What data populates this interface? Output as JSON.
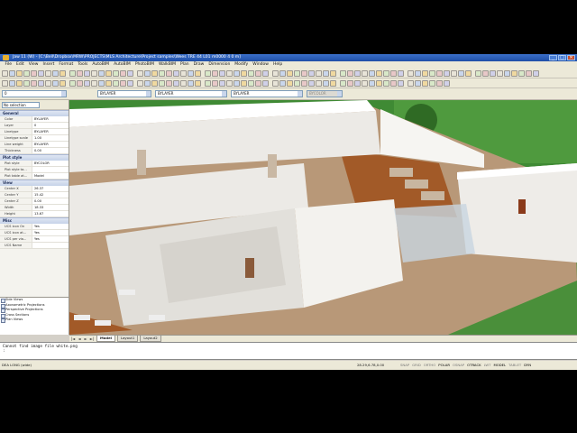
{
  "window": {
    "title": "Jaw 11 (W) - [C:\\Bell\\Dropbox\\MRW\\PROJECTS\\MLS Architecture\\Project samples\\Wees TRE 44 L01 m0000 4 0 m]",
    "controls": [
      "_",
      "□",
      "✕"
    ]
  },
  "menu": [
    "File",
    "Edit",
    "View",
    "Insert",
    "Format",
    "Tools",
    "AutoBIM",
    "AutoBIM",
    "PhotoBIM",
    "WalkBIM",
    "Plan",
    "Draw",
    "Dimension",
    "Modify",
    "Window",
    "Help"
  ],
  "properties_bar": {
    "layer": "0",
    "color": "BYLAYER",
    "linetype": "BYLAYER",
    "lineweight": "BYLAYER",
    "plotstyle": "BYCOLOR"
  },
  "panel": {
    "selection": "No selection",
    "sections": [
      {
        "title": "General",
        "props": [
          {
            "k": "Color",
            "v": "BYLAYER"
          },
          {
            "k": "Layer",
            "v": "0"
          },
          {
            "k": "Linetype",
            "v": "BYLAYER"
          },
          {
            "k": "Linetype scale",
            "v": "1.00"
          },
          {
            "k": "Line weight",
            "v": "BYLAYER"
          },
          {
            "k": "Thickness",
            "v": "0.00"
          }
        ]
      },
      {
        "title": "Plot style",
        "props": [
          {
            "k": "Plot style",
            "v": "BYCOLOR"
          },
          {
            "k": "Plot style ta...",
            "v": ""
          },
          {
            "k": "Plot table at...",
            "v": "Model"
          }
        ]
      },
      {
        "title": "View",
        "props": [
          {
            "k": "Center X",
            "v": "26.37"
          },
          {
            "k": "Center Y",
            "v": "15.42"
          },
          {
            "k": "Center Z",
            "v": "0.00"
          },
          {
            "k": "Width",
            "v": "18.33"
          },
          {
            "k": "Height",
            "v": "13.67"
          }
        ]
      },
      {
        "title": "Misc",
        "props": [
          {
            "k": "UCS icon On",
            "v": "Yes"
          },
          {
            "k": "UCS icon at...",
            "v": "Yes"
          },
          {
            "k": "UCS per via...",
            "v": "Yes"
          },
          {
            "k": "UCS Name",
            "v": ""
          }
        ]
      }
    ],
    "tree": [
      "Side Views",
      "Axonometric Projections",
      "Perspective Projections",
      "Cross Sections",
      "Plan Views"
    ]
  },
  "layout_tabs": {
    "nav": [
      "|◄",
      "◄",
      "►",
      "►|"
    ],
    "tabs": [
      "Model",
      "Layout1",
      "Layout2"
    ],
    "active": "Model"
  },
  "command": {
    "lines": [
      "Cannot find image file white.png",
      ":"
    ]
  },
  "status": {
    "left": "DEA LONG (wide)",
    "coords": "28.29,6.78,0.00",
    "toggles": [
      {
        "label": "SNAP",
        "on": false
      },
      {
        "label": "GRID",
        "on": false
      },
      {
        "label": "ORTHO",
        "on": false
      },
      {
        "label": "POLAR",
        "on": true
      },
      {
        "label": "OSNAP",
        "on": false
      },
      {
        "label": "OTRACK",
        "on": true
      },
      {
        "label": "LWT",
        "on": false
      },
      {
        "label": "MODEL",
        "on": true
      },
      {
        "label": "TABLET",
        "on": false
      },
      {
        "label": "DYN",
        "on": true
      }
    ]
  },
  "scene": {
    "grass_color": "#3f8a34",
    "wall_color": "#eceae6",
    "floor_color": "#b89878",
    "wood_color": "#a25a28",
    "water_color": "#8aa6c6"
  }
}
